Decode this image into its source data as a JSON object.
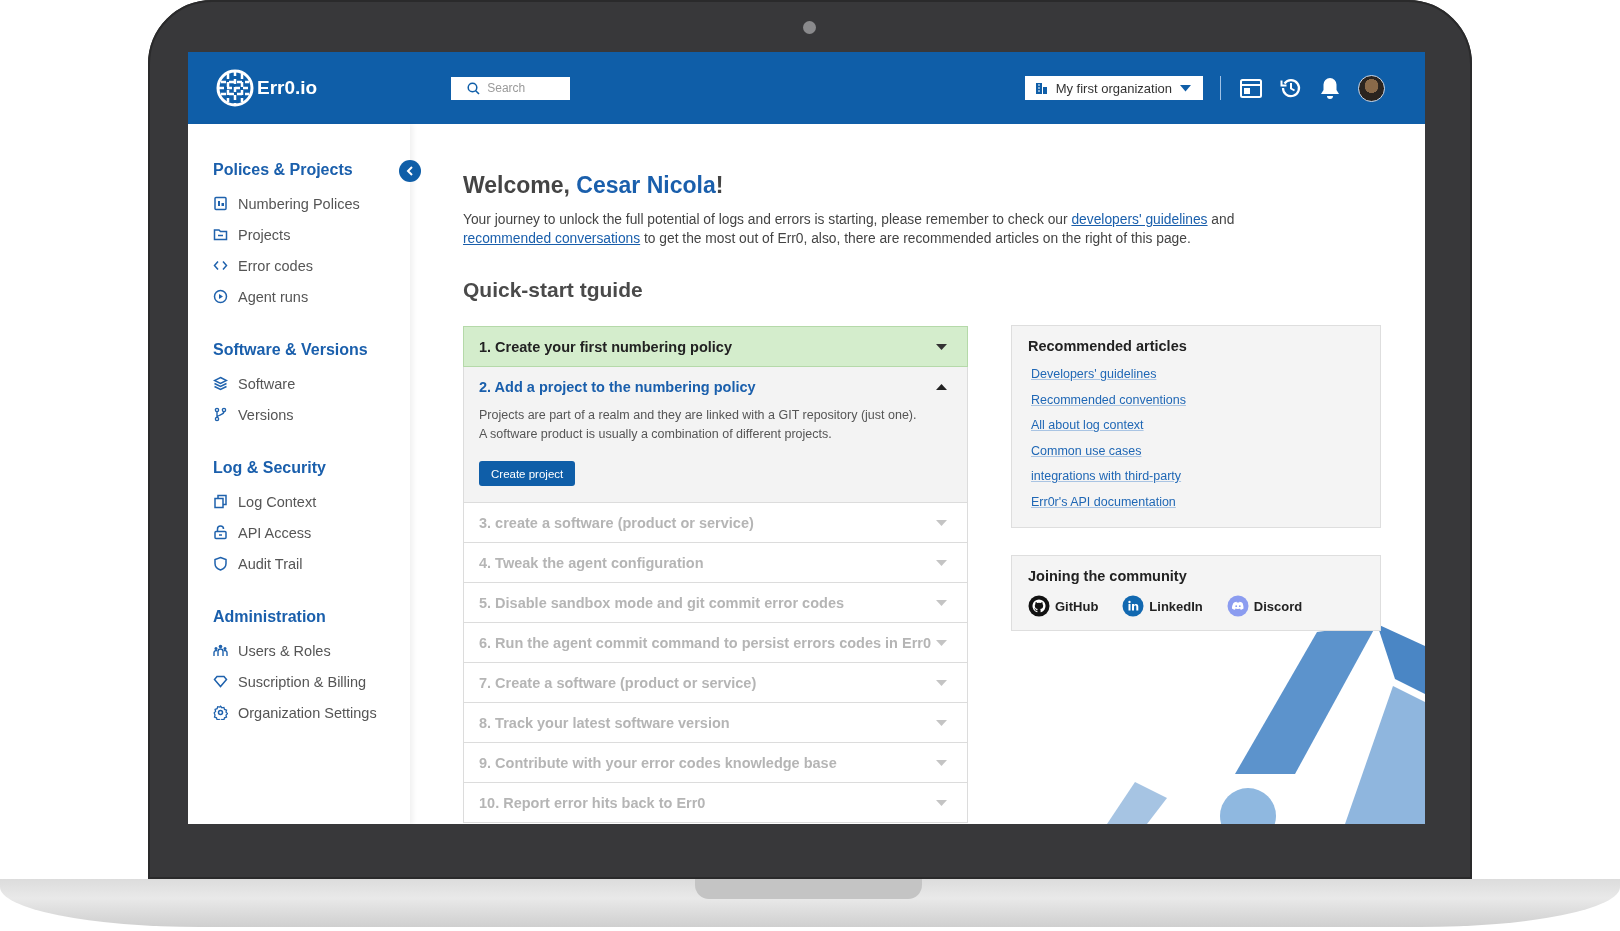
{
  "header": {
    "logo": "Err0.io",
    "search": {
      "placeholder": "Search"
    },
    "organization": "My first organization"
  },
  "sidebar": {
    "sections": [
      {
        "title": "Polices & Projects",
        "items": [
          "Numbering Polices",
          "Projects",
          "Error codes",
          "Agent runs"
        ]
      },
      {
        "title": "Software & Versions",
        "items": [
          "Software",
          "Versions"
        ]
      },
      {
        "title": "Log & Security",
        "items": [
          "Log Context",
          "API Access",
          "Audit Trail"
        ]
      },
      {
        "title": "Administration",
        "items": [
          "Users & Roles",
          "Suscription & Billing",
          "Organization Settings"
        ]
      }
    ]
  },
  "welcome": {
    "heading": {
      "prefix": "Welcome, ",
      "name": "Cesar Nicola",
      "suffix": "!"
    },
    "intro": [
      {
        "kind": "text",
        "text": "Your journey to unlock the full potential of logs and errors is starting, please remember to check our "
      },
      {
        "kind": "link",
        "text": "developers' guidelines"
      },
      {
        "kind": "text",
        "text": " and "
      },
      {
        "kind": "link",
        "text": "recommended conversations"
      },
      {
        "kind": "text",
        "text": " to get the most out of Err0, also, there are recommended articles on the right of this page."
      }
    ]
  },
  "guide": {
    "title": "Quick-start tguide",
    "steps": [
      {
        "title": "1. Create your first numbering policy",
        "completed": true,
        "disabled": false,
        "expanded": false
      },
      {
        "title": "2. Add a project to the numbering policy",
        "completed": false,
        "disabled": false,
        "expanded": true,
        "description": [
          "Projects are part of a realm and they are linked with a GIT repository (just one).",
          "A software product is usually a combination of different projects."
        ],
        "button": "Create project"
      },
      {
        "title": "3. create a software (product or service)",
        "completed": false,
        "disabled": true,
        "expanded": false
      },
      {
        "title": "4. Tweak the agent configuration",
        "completed": false,
        "disabled": true,
        "expanded": false
      },
      {
        "title": "5. Disable sandbox mode and git commit error codes",
        "completed": false,
        "disabled": true,
        "expanded": false
      },
      {
        "title": "6. Run the agent commit command to persist errors codes in Err0",
        "completed": false,
        "disabled": true,
        "expanded": false
      },
      {
        "title": "7. Create a software (product or service)",
        "completed": false,
        "disabled": true,
        "expanded": false
      },
      {
        "title": "8. Track your latest software version",
        "completed": false,
        "disabled": true,
        "expanded": false
      },
      {
        "title": "9. Contribute with your error codes knowledge base",
        "completed": false,
        "disabled": true,
        "expanded": false
      },
      {
        "title": "10. Report error hits back to Err0",
        "completed": false,
        "disabled": true,
        "expanded": false
      }
    ]
  },
  "recommended": {
    "title": "Recommended articles",
    "links": [
      "Developers' guidelines",
      "Recommended conventions",
      "All about log context",
      "Common use cases",
      "integrations with third-party",
      "Err0r's API documentation"
    ]
  },
  "community": {
    "title": "Joining the community",
    "links": [
      "GitHub",
      "LinkedIn",
      "Discord"
    ]
  }
}
